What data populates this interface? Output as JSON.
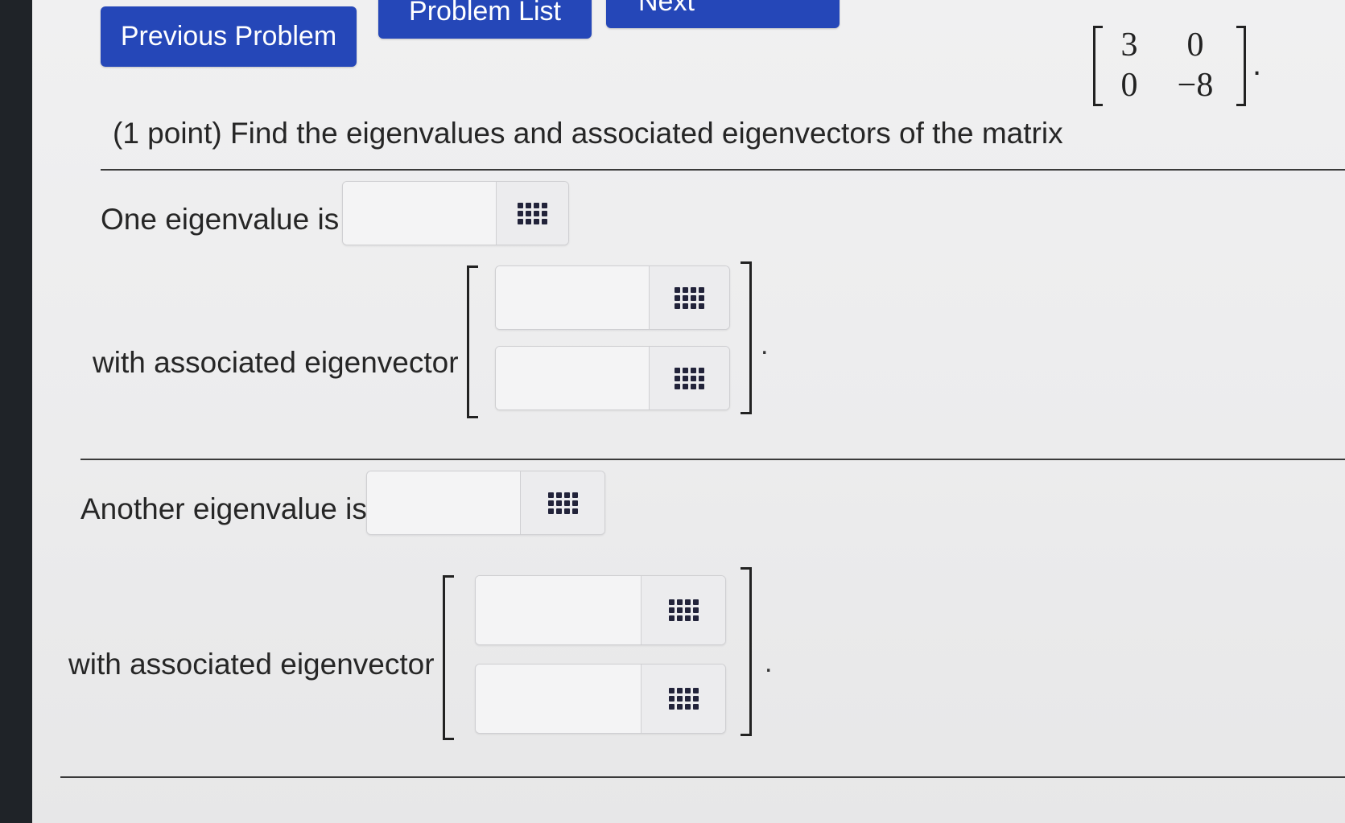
{
  "nav": {
    "previous_label": "Previous Problem",
    "list_label": "Problem List",
    "next_label": "Next"
  },
  "question": {
    "prompt": "(1 point) Find the eigenvalues and associated eigenvectors of the matrix",
    "matrix": [
      [
        "3",
        "0"
      ],
      [
        "0",
        "−8"
      ]
    ],
    "end_punct": "."
  },
  "part1": {
    "eigenvalue_label": "One eigenvalue is",
    "eigenvalue_value": "",
    "eigenvector_label": "with associated eigenvector",
    "eigenvector_values": [
      "",
      ""
    ],
    "end_punct": "."
  },
  "part2": {
    "eigenvalue_label": "Another eigenvalue is",
    "eigenvalue_value": "",
    "eigenvector_label": "with associated eigenvector",
    "eigenvector_values": [
      "",
      ""
    ],
    "end_punct": "."
  },
  "icons": {
    "answer_tool": "grid-icon"
  },
  "colors": {
    "nav_button": "#2547b8",
    "page_bg": "#ececed"
  }
}
